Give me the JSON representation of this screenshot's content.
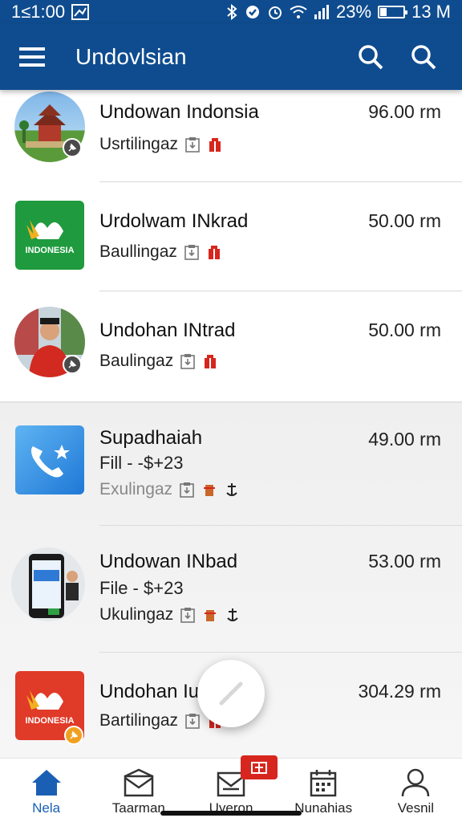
{
  "status_bar": {
    "time": "1≤1:00",
    "battery": "23%",
    "right_text": "13 M"
  },
  "app_bar": {
    "title": "Undovlsian"
  },
  "items": [
    {
      "title": "Undowan Indonsia",
      "subtitle": "",
      "meta": "Usrtilingaz",
      "price": "96.00 rm"
    },
    {
      "title": "Urdolwam INkrad",
      "subtitle": "",
      "meta": "Baullingaz",
      "price": "50.00 rm",
      "logo_text": "INDONESIA"
    },
    {
      "title": "Undohan INtrad",
      "subtitle": "",
      "meta": "Baulingaz",
      "price": "50.00 rm"
    },
    {
      "title": "Supadhaiah",
      "subtitle": "Fill - -$+23",
      "meta": "Exulingaz",
      "price": "49.00 rm"
    },
    {
      "title": "Undowan INbad",
      "subtitle": "File - $+23",
      "meta": "Ukulingaz",
      "price": "53.00 rm"
    },
    {
      "title": "Undohan Iu",
      "subtitle": "",
      "meta": "Bartilingaz",
      "price": "304.29 rm",
      "logo_text": "INDONESIA"
    }
  ],
  "bottom_nav": [
    {
      "label": "Nela",
      "icon": "home-icon"
    },
    {
      "label": "Taarman",
      "icon": "mail-icon"
    },
    {
      "label": "Uyeron",
      "icon": "inbox-icon"
    },
    {
      "label": "Nunahias",
      "icon": "calendar-icon"
    },
    {
      "label": "Vesnil",
      "icon": "person-icon"
    }
  ],
  "colors": {
    "primary": "#0f4c8f",
    "accent": "#1a5fb4",
    "badge": "#d7261e"
  }
}
